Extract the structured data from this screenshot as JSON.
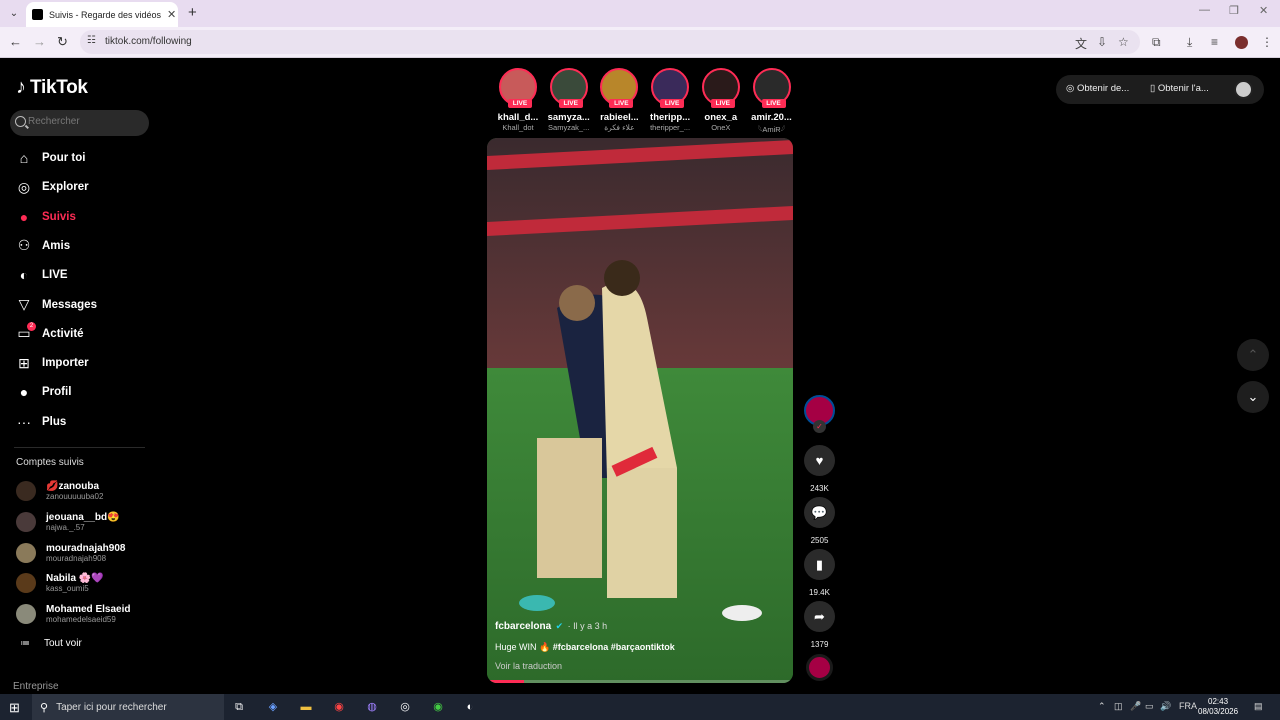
{
  "browser": {
    "tab_title": "Suivis - Regarde des vidéos de c",
    "url": "tiktok.com/following"
  },
  "sidebar": {
    "logo": "TikTok",
    "search_placeholder": "Rechercher",
    "nav": [
      {
        "label": "Pour toi",
        "icon": "home-icon"
      },
      {
        "label": "Explorer",
        "icon": "compass-icon"
      },
      {
        "label": "Suivis",
        "icon": "following-icon",
        "active": true
      },
      {
        "label": "Amis",
        "icon": "friends-icon"
      },
      {
        "label": "LIVE",
        "icon": "live-icon"
      },
      {
        "label": "Messages",
        "icon": "messages-icon"
      },
      {
        "label": "Activité",
        "icon": "activity-icon",
        "badge": "2"
      },
      {
        "label": "Importer",
        "icon": "upload-icon"
      },
      {
        "label": "Profil",
        "icon": "profile-icon"
      },
      {
        "label": "Plus",
        "icon": "more-icon"
      }
    ],
    "followed_title": "Comptes suivis",
    "followed": [
      {
        "name": "💋zanouba",
        "handle": "zanouuuuuba02",
        "color": "#3a2a20"
      },
      {
        "name": "jeouana__bd😍",
        "handle": "najwa._.57",
        "color": "#4a3a3a"
      },
      {
        "name": "mouradnajah908",
        "handle": "mouradnajah908",
        "color": "#8a7a5a"
      },
      {
        "name": "Nabila 🌸💜",
        "handle": "kass_oumi5",
        "color": "#5a3a1a"
      },
      {
        "name": "Mohamed Elsaeid",
        "handle": "mohamedelsaeid59",
        "color": "#8a8a7a"
      }
    ],
    "see_all": "Tout voir",
    "company": "Entreprise"
  },
  "stories": {
    "live_label": "LIVE",
    "items": [
      {
        "name": "khall_d...",
        "handle": "Khall_dot",
        "color": "#c85a5a"
      },
      {
        "name": "samyza...",
        "handle": "Samyzak_...",
        "color": "#3a4a3a"
      },
      {
        "name": "rabieel...",
        "handle": "علاء فكرة",
        "color": "#b8862a"
      },
      {
        "name": "theripp...",
        "handle": "theripper_...",
        "color": "#3a2a5a"
      },
      {
        "name": "onex_a",
        "handle": "OneX",
        "color": "#2a1a1a"
      },
      {
        "name": "amir.20...",
        "handle": "𓆩AmiR𓆪",
        "color": "#2a2a2a"
      }
    ]
  },
  "topright": {
    "coins_label": "Obtenir de...",
    "app_label": "Obtenir l'a..."
  },
  "video": {
    "author": "fcbarcelona",
    "time": "· Il y a 3 h",
    "caption_text": "Huge WIN 🔥",
    "caption_tags": "#fcbarcelona #barçaontiktok",
    "translate": "Voir la traduction",
    "progress": 0.12
  },
  "actions": {
    "likes": "243K",
    "comments": "2505",
    "saves": "19.4K",
    "shares": "1379"
  },
  "taskbar": {
    "search_label": "Taper ici pour rechercher",
    "language": "FRA",
    "time": "02:43",
    "date": "08/03/2026"
  },
  "colors": {
    "accent": "#fe2c55",
    "barca_blue": "#004d98",
    "barca_red": "#a50044"
  }
}
